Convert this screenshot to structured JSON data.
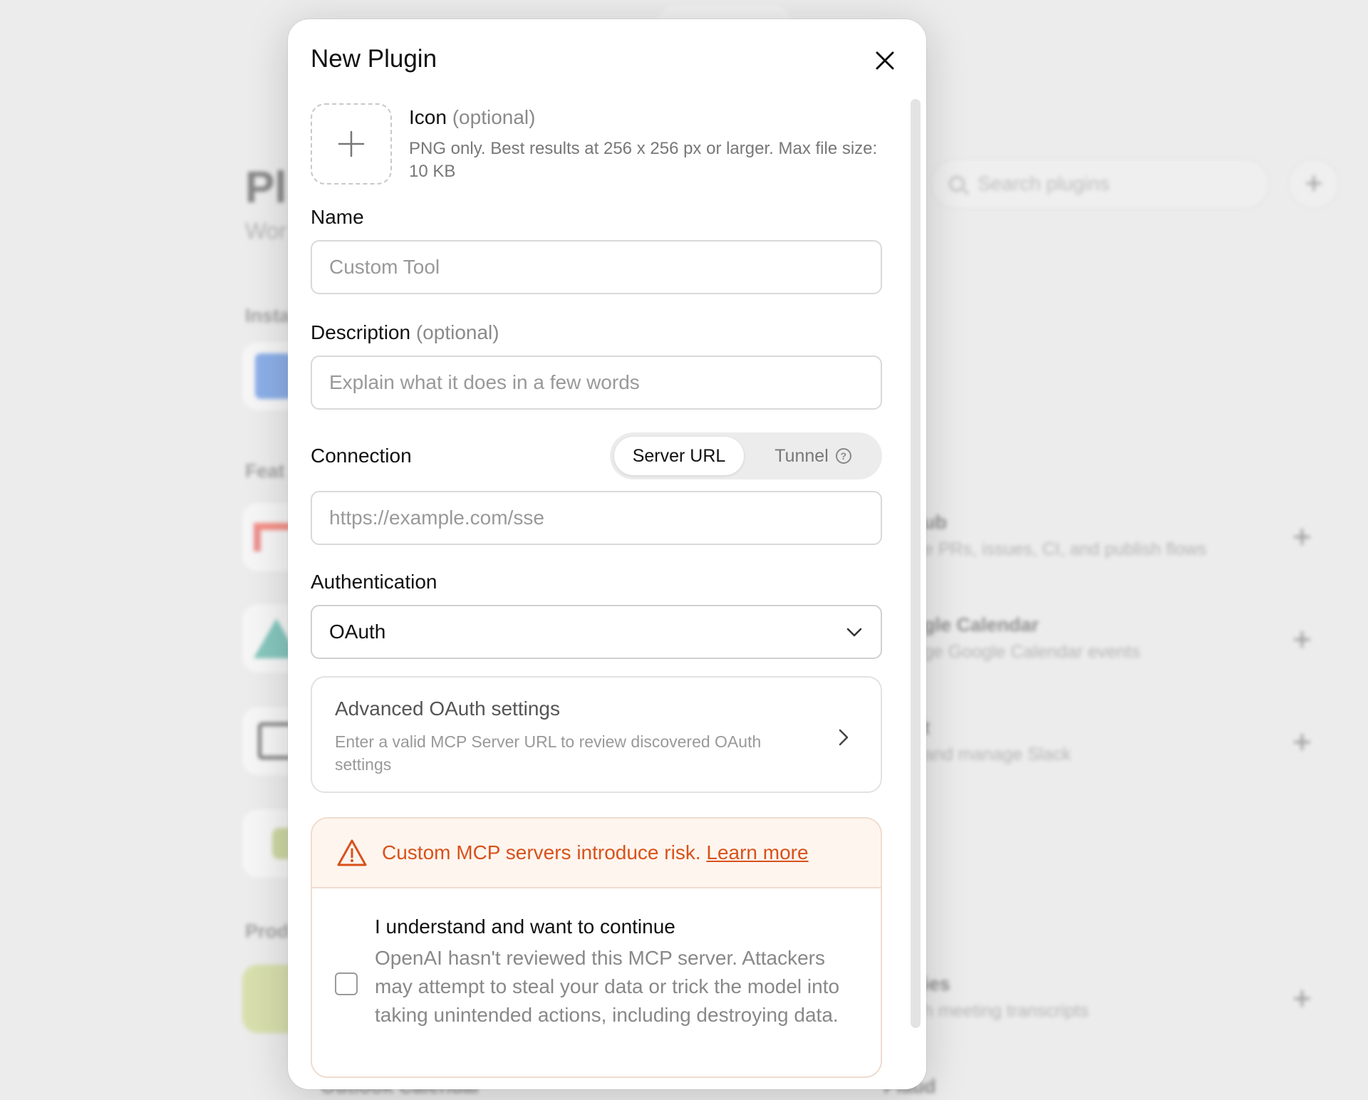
{
  "background": {
    "page_title": "Pl",
    "page_subtitle": "Wor",
    "section_installed": "Insta",
    "section_featured": "Feat",
    "section_productivity": "Prod",
    "search_placeholder": "Search plugins",
    "add_label": "+",
    "rows": [
      {
        "title": "ub",
        "sub": "e PRs, issues, CI, and publish flows"
      },
      {
        "title": "gle Calendar",
        "sub": "ge Google Calendar events"
      },
      {
        "title": "t",
        "sub": "and manage Slack"
      },
      {
        "title": "ies",
        "sub": "h meeting transcripts"
      }
    ],
    "bottom_left": "Outlook Calendar",
    "bottom_right": "Plaud"
  },
  "modal": {
    "title": "New Plugin",
    "icon": {
      "label": "Icon",
      "optional": "(optional)",
      "hint": "PNG only. Best results at 256 x 256 px or larger. Max file size: 10 KB"
    },
    "name": {
      "label": "Name",
      "placeholder": "Custom Tool",
      "value": ""
    },
    "description": {
      "label": "Description",
      "optional": "(optional)",
      "placeholder": "Explain what it does in a few words",
      "value": ""
    },
    "connection": {
      "label": "Connection",
      "options": [
        "Server URL",
        "Tunnel"
      ],
      "selected": "Server URL",
      "url_placeholder": "https://example.com/sse",
      "url_value": ""
    },
    "authentication": {
      "label": "Authentication",
      "selected": "OAuth"
    },
    "advanced": {
      "title": "Advanced OAuth settings",
      "subtitle": "Enter a valid MCP Server URL to review discovered OAuth settings"
    },
    "risk": {
      "warning": "Custom MCP servers introduce risk.",
      "link": "Learn more",
      "ack_title": "I understand and want to continue",
      "ack_desc": "OpenAI hasn't reviewed this MCP server. Attackers may attempt to steal your data or trick the model into taking unintended actions, including destroying data.",
      "checked": false
    }
  },
  "colors": {
    "warning": "#d8521a",
    "warning_bg": "#fff5ef"
  }
}
